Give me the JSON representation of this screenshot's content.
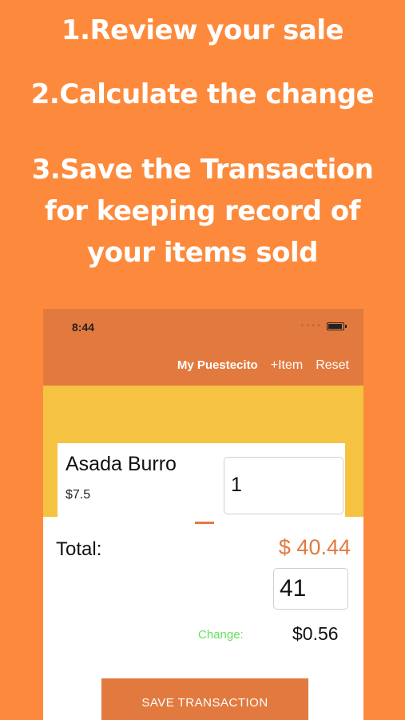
{
  "headlines": {
    "line1": "1.Review your sale",
    "line2": "2.Calculate the change",
    "line3a": "3.Save the Transaction",
    "line3b": "for keeping record of",
    "line3c": "your items sold"
  },
  "status_bar": {
    "time": "8:44",
    "signal": "••••"
  },
  "navbar": {
    "title": "My Puestecito",
    "add_item_label": "+Item",
    "reset_label": "Reset"
  },
  "item": {
    "name": "Asada Burro",
    "price": "$7.5",
    "quantity": "1"
  },
  "totals": {
    "total_label": "Total:",
    "total_value": "$ 40.44",
    "amount_paid": "41",
    "change_label": "Change:",
    "change_value": "$0.56"
  },
  "save_button_label": "SAVE TRANSACTION",
  "colors": {
    "background": "#FD8A3C",
    "navbar": "#E27A3F",
    "band": "#F5C242",
    "accent": "#E27A3F",
    "change_label": "#66E05A"
  }
}
